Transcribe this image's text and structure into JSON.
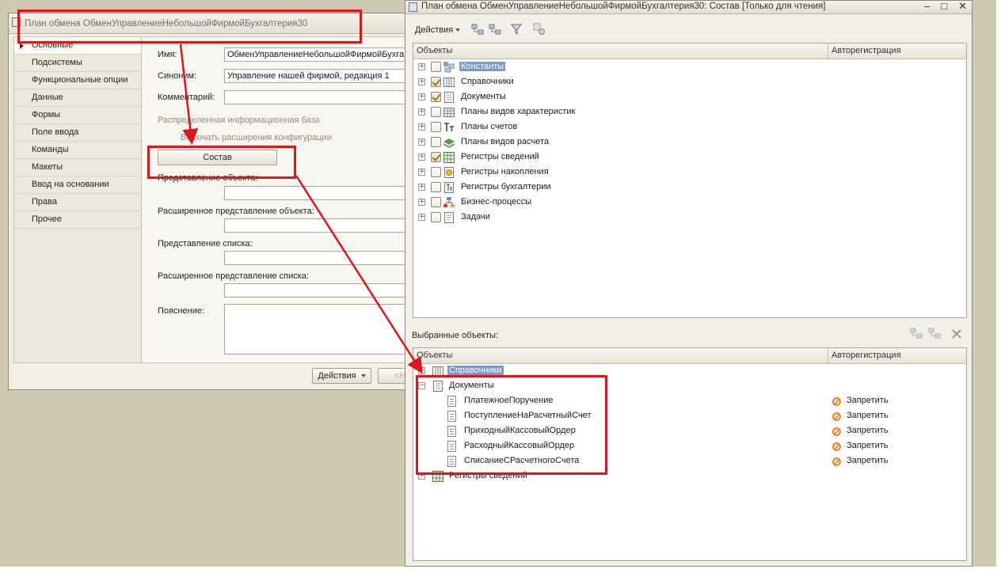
{
  "left_window": {
    "title": "План обмена ОбменУправлениеНебольшойФирмойБухгалтерия30",
    "nav_items": [
      {
        "label": "Основные"
      },
      {
        "label": "Подсистемы"
      },
      {
        "label": "Функциональные опции"
      },
      {
        "label": "Данные"
      },
      {
        "label": "Формы"
      },
      {
        "label": "Поле ввода"
      },
      {
        "label": "Команды"
      },
      {
        "label": "Макеты"
      },
      {
        "label": "Ввод на основании"
      },
      {
        "label": "Права"
      },
      {
        "label": "Прочее"
      }
    ],
    "fields": {
      "name_label": "Имя:",
      "name_value": "ОбменУправлениеНебольшойФирмойБухга",
      "synonym_label": "Синоним:",
      "synonym_value": "Управление нашей фирмой, редакция 1",
      "comment_label": "Комментарий:",
      "distributed_label": "Распределенная информационная база",
      "extensions_label": "Включать расширения конфигурации",
      "compose_button": "Состав",
      "object_presentation_label": "Представление объекта:",
      "ext_object_presentation_label": "Расширенное представление объекта:",
      "list_presentation_label": "Представление списка:",
      "ext_list_presentation_label": "Расширенное представление списка:",
      "explanation_label": "Пояснение:"
    },
    "bottom": {
      "actions_button": "Действия",
      "nav_button_partial": "<Н"
    }
  },
  "right_window": {
    "title": "План обмена ОбменУправлениеНебольшойФирмойБухгалтерия30: Состав [Только для чтения]",
    "toolbar": {
      "actions_button": "Действия"
    },
    "objects_header": {
      "col_objects": "Объекты",
      "col_autoreg": "Авторегистрация"
    },
    "objects": [
      {
        "label": "Константы",
        "checked": false,
        "icon": "constants-icon",
        "selected": true
      },
      {
        "label": "Справочники",
        "checked": true,
        "icon": "catalogs-icon",
        "selected": false
      },
      {
        "label": "Документы",
        "checked": true,
        "icon": "documents-icon",
        "selected": false
      },
      {
        "label": "Планы видов характеристик",
        "checked": false,
        "icon": "characteristic-types-icon",
        "selected": false
      },
      {
        "label": "Планы счетов",
        "checked": false,
        "icon": "chart-of-accounts-icon",
        "selected": false
      },
      {
        "label": "Планы видов расчета",
        "checked": false,
        "icon": "calculation-types-icon",
        "selected": false
      },
      {
        "label": "Регистры сведений",
        "checked": true,
        "icon": "information-registers-icon",
        "selected": false
      },
      {
        "label": "Регистры накопления",
        "checked": false,
        "icon": "accumulation-registers-icon",
        "selected": false
      },
      {
        "label": "Регистры бухгалтерии",
        "checked": false,
        "icon": "accounting-registers-icon",
        "selected": false
      },
      {
        "label": "Бизнес-процессы",
        "checked": false,
        "icon": "business-processes-icon",
        "selected": false
      },
      {
        "label": "Задачи",
        "checked": false,
        "icon": "tasks-icon",
        "selected": false
      }
    ],
    "selected_section_label": "Выбранные объекты:",
    "selected_header": {
      "col_objects": "Объекты",
      "col_autoreg": "Авторегистрация"
    },
    "selected_groups": {
      "catalogs": "Справочники",
      "documents": "Документы",
      "registers": "Регистры сведений"
    },
    "documents": [
      {
        "name": "ПлатежноеПоручение",
        "autoreg": "Запретить"
      },
      {
        "name": "ПоступлениеНаРасчетныйСчет",
        "autoreg": "Запретить"
      },
      {
        "name": "ПриходныйКассовыйОрдер",
        "autoreg": "Запретить"
      },
      {
        "name": "РасходныйКассовыйОрдер",
        "autoreg": "Запретить"
      },
      {
        "name": "СписаниеСРасчетногоСчета",
        "autoreg": "Запретить"
      }
    ]
  },
  "annotation_color": "#e0141b"
}
